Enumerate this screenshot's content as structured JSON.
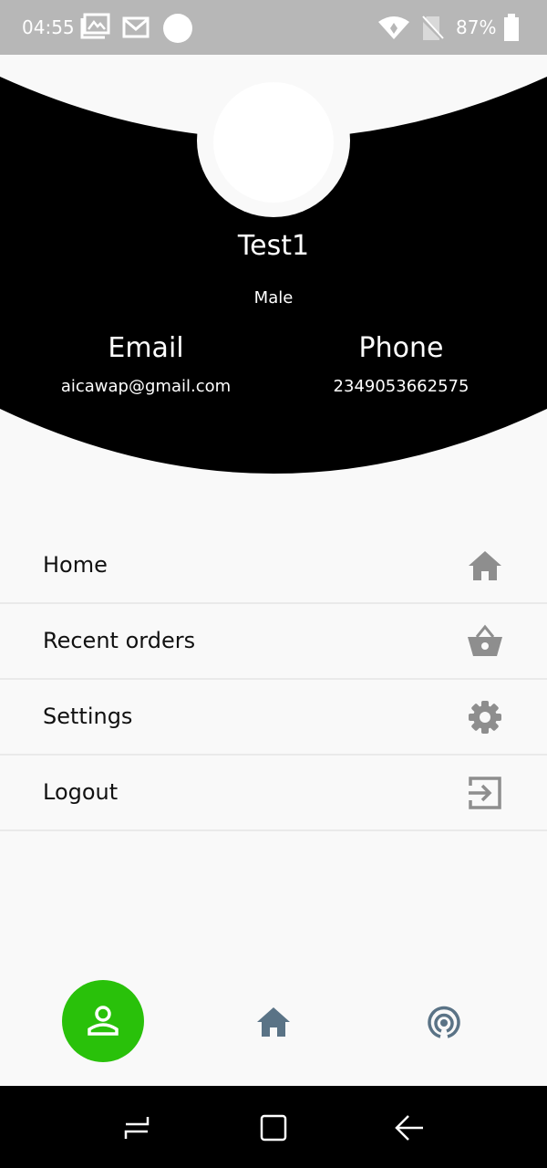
{
  "status_bar": {
    "time": "04:55",
    "battery": "87%",
    "icons": [
      "photo-icon",
      "gmail-icon",
      "notification-dot-icon",
      "wifi-icon",
      "no-sim-icon",
      "battery-icon"
    ]
  },
  "profile": {
    "name": "Test1",
    "gender": "Male",
    "email_label": "Email",
    "email": "aicawap@gmail.com",
    "phone_label": "Phone",
    "phone": "2349053662575"
  },
  "menu": {
    "items": [
      {
        "label": "Home",
        "icon": "home-icon"
      },
      {
        "label": "Recent orders",
        "icon": "basket-icon"
      },
      {
        "label": "Settings",
        "icon": "gear-icon"
      },
      {
        "label": "Logout",
        "icon": "logout-icon"
      }
    ]
  },
  "bottom_nav": {
    "items": [
      {
        "icon": "person-icon",
        "active": true
      },
      {
        "icon": "home-icon",
        "active": false
      },
      {
        "icon": "live-icon",
        "active": false
      }
    ]
  },
  "colors": {
    "header": "#000000",
    "active_nav": "#29c10a",
    "menu_icon": "#8e8e8e",
    "nav_icon": "#5a7386",
    "status_bar": "#b7b7b7"
  }
}
